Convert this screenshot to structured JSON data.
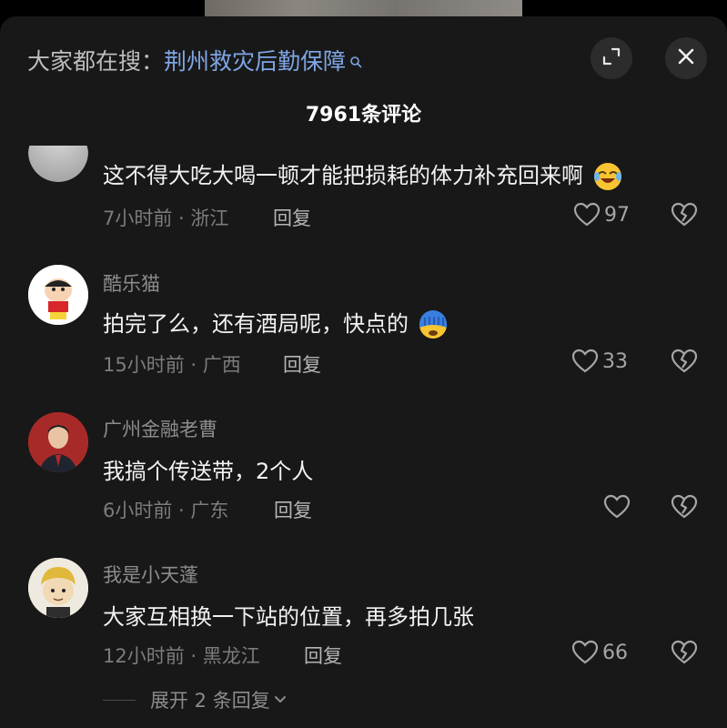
{
  "header": {
    "search_prefix": "大家都在搜：",
    "search_term": "荆州救灾后勤保障",
    "comment_count_label": "7961条评论"
  },
  "icons": {
    "search": "search-icon",
    "expand": "expand-icon",
    "close": "close-icon",
    "like": "heart-icon",
    "dislike": "broken-heart-icon"
  },
  "colors": {
    "sheet_bg": "#181818",
    "search_link": "#7fa6e6",
    "secondary_text": "#8c8c8c"
  },
  "comments": [
    {
      "username": "",
      "text": "这不得大吃大喝一顿才能把损耗的体力补充回来啊",
      "emoji": "laughing-crying-emoji",
      "time": "7小时前",
      "location": "浙江",
      "meta": "7小时前 · 浙江",
      "reply_label": "回复",
      "likes": "97"
    },
    {
      "username": "酷乐猫",
      "text": "拍完了么，还有酒局呢，快点的",
      "emoji": "cold-sweat-emoji",
      "time": "15小时前",
      "location": "广西",
      "meta": "15小时前 · 广西",
      "reply_label": "回复",
      "likes": "33"
    },
    {
      "username": "广州金融老曹",
      "text": "我搞个传送带，2个人",
      "time": "6小时前",
      "location": "广东",
      "meta": "6小时前 · 广东",
      "reply_label": "回复",
      "likes": ""
    },
    {
      "username": "我是小天蓬",
      "text": "大家互相换一下站的位置，再多拍几张",
      "time": "12小时前",
      "location": "黑龙江",
      "meta": "12小时前 · 黑龙江",
      "reply_label": "回复",
      "likes": "66",
      "expand_replies_label": "展开 2 条回复"
    }
  ]
}
